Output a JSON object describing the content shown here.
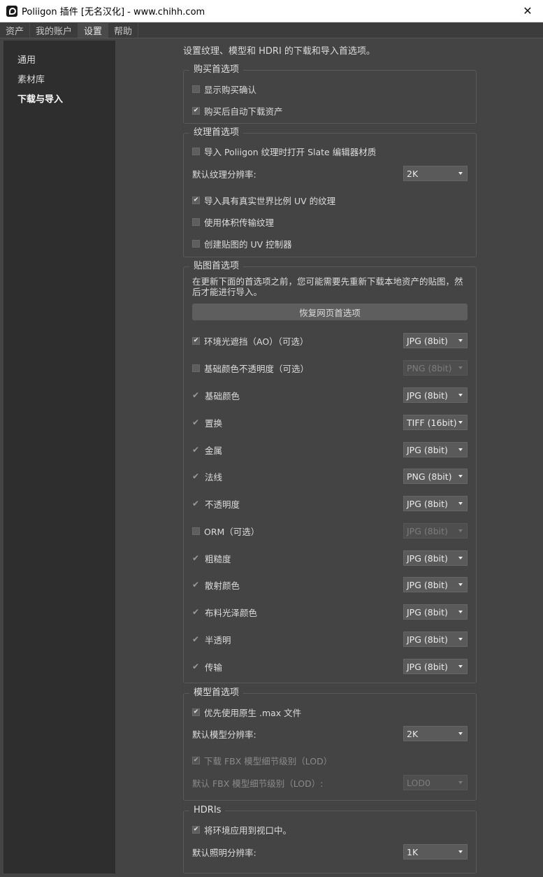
{
  "window": {
    "title": "Poliigon 插件 [无名汉化] - www.chihh.com",
    "close_glyph": "✕"
  },
  "tabs": [
    {
      "label": "资产"
    },
    {
      "label": "我的账户"
    },
    {
      "label": "设置"
    },
    {
      "label": "帮助"
    }
  ],
  "sidebar": {
    "items": [
      {
        "label": "通用"
      },
      {
        "label": "素材库"
      },
      {
        "label": "下载与导入"
      }
    ]
  },
  "intro": "设置纹理、模型和 HDRI 的下载和导入首选项。",
  "purchase": {
    "title": "购买首选项",
    "show_confirm": "显示购买确认",
    "auto_download": "购买后自动下载资产"
  },
  "texture": {
    "title": "纹理首选项",
    "open_slate": "导入 Poliigon 纹理时打开 Slate 编辑器材质",
    "default_res_label": "默认纹理分辨率:",
    "default_res_value": "2K",
    "real_world_uv": "导入具有真实世界比例 UV 的纹理",
    "volume_transmission": "使用体积传输纹理",
    "uv_controller": "创建贴图的 UV 控制器"
  },
  "maps": {
    "title": "贴图首选项",
    "note": "在更新下面的首选项之前，您可能需要先重新下载本地资产的贴图，然后才能进行导入。",
    "restore_button": "恢复网页首选项",
    "items": [
      {
        "label": "环境光遮挡（AO）（可选）",
        "value": "JPG (8bit)"
      },
      {
        "label": "基础颜色不透明度（可选）",
        "value": "PNG (8bit)"
      },
      {
        "label": "基础颜色",
        "value": "JPG (8bit)"
      },
      {
        "label": "置换",
        "value": "TIFF (16bit)"
      },
      {
        "label": "金属",
        "value": "JPG (8bit)"
      },
      {
        "label": "法线",
        "value": "PNG (8bit)"
      },
      {
        "label": "不透明度",
        "value": "JPG (8bit)"
      },
      {
        "label": "ORM（可选）",
        "value": "JPG (8bit)"
      },
      {
        "label": "粗糙度",
        "value": "JPG (8bit)"
      },
      {
        "label": "散射颜色",
        "value": "JPG (8bit)"
      },
      {
        "label": "布料光泽颜色",
        "value": "JPG (8bit)"
      },
      {
        "label": "半透明",
        "value": "JPG (8bit)"
      },
      {
        "label": "传输",
        "value": "JPG (8bit)"
      }
    ]
  },
  "model": {
    "title": "模型首选项",
    "prefer_max": "优先使用原生 .max 文件",
    "default_res_label": "默认模型分辨率:",
    "default_res_value": "2K",
    "download_fbx_lod": "下载 FBX 模型细节级别（LOD）",
    "default_fbx_lod_label": "默认 FBX 模型细节级别（LOD）:",
    "default_fbx_lod_value": "LOD0"
  },
  "hdri": {
    "title": "HDRIs",
    "apply_viewport": "将环境应用到视口中。",
    "default_light_res_label": "默认照明分辨率:",
    "default_light_res_value": "1K"
  }
}
